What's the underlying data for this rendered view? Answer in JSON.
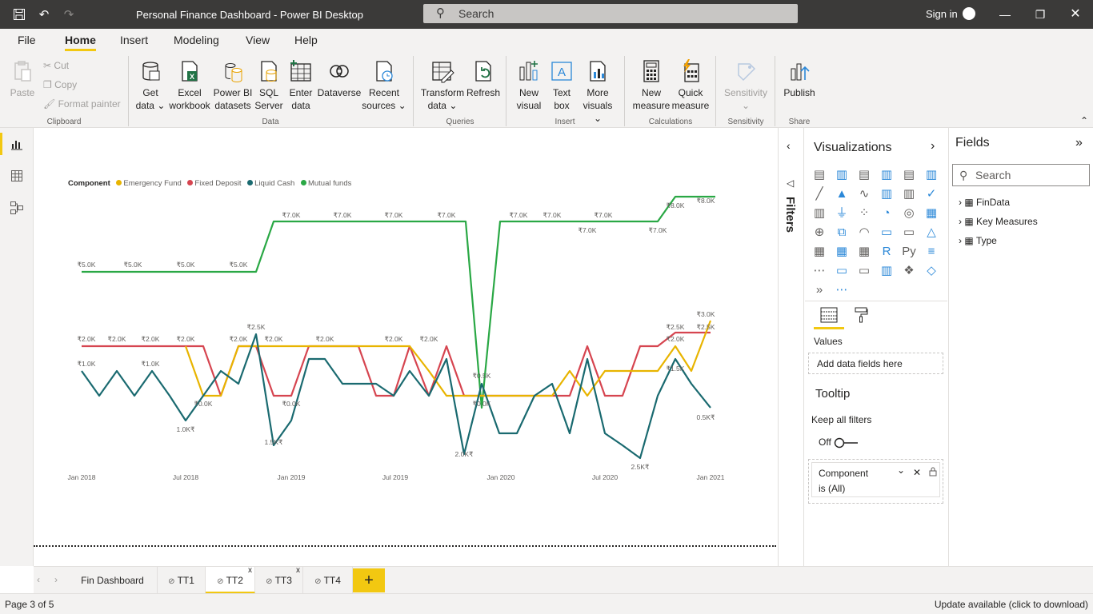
{
  "window": {
    "title": "Personal Finance Dashboard - Power BI Desktop",
    "search_placeholder": "Search",
    "sign_in": "Sign in"
  },
  "menu": [
    "File",
    "Home",
    "Insert",
    "Modeling",
    "View",
    "Help"
  ],
  "ribbon": {
    "clipboard": {
      "paste": "Paste",
      "cut": "Cut",
      "copy": "Copy",
      "format_painter": "Format painter",
      "group": "Clipboard"
    },
    "data": {
      "get_data": [
        "Get",
        "data"
      ],
      "excel": [
        "Excel",
        "workbook"
      ],
      "pbi": [
        "Power BI",
        "datasets"
      ],
      "sql": [
        "SQL",
        "Server"
      ],
      "enter": [
        "Enter",
        "data"
      ],
      "dataverse": "Dataverse",
      "recent": [
        "Recent",
        "sources"
      ],
      "group": "Data"
    },
    "queries": {
      "transform": [
        "Transform",
        "data"
      ],
      "refresh": "Refresh",
      "group": "Queries"
    },
    "insert": {
      "new_visual": [
        "New",
        "visual"
      ],
      "text_box": [
        "Text",
        "box"
      ],
      "more_visuals": [
        "More",
        "visuals"
      ],
      "group": "Insert"
    },
    "calc": {
      "new_measure": [
        "New",
        "measure"
      ],
      "quick_measure": [
        "Quick",
        "measure"
      ],
      "group": "Calculations"
    },
    "sensitivity": {
      "label": "Sensitivity",
      "group": "Sensitivity"
    },
    "share": {
      "publish": "Publish",
      "group": "Share"
    }
  },
  "filters_label": "Filters",
  "visualizations": {
    "title": "Visualizations",
    "values_label": "Values",
    "values_placeholder": "Add data fields here",
    "tooltip_label": "Tooltip",
    "keep_filters": "Keep all filters",
    "toggle_state": "Off",
    "filter_card": {
      "field": "Component",
      "condition": "is (All)"
    }
  },
  "fields": {
    "title": "Fields",
    "search_placeholder": "Search",
    "tables": [
      "FinData",
      "Key Measures",
      "Type"
    ]
  },
  "tabs": [
    {
      "label": "Fin Dashboard",
      "hidden": false
    },
    {
      "label": "TT1",
      "hidden": true
    },
    {
      "label": "TT2",
      "hidden": true
    },
    {
      "label": "TT3",
      "hidden": true
    },
    {
      "label": "TT4",
      "hidden": true
    }
  ],
  "tab_add_glyph": "+",
  "status": {
    "page": "Page 3 of 5",
    "update": "Update available (click to download)"
  },
  "colors": {
    "accent": "#f2c811",
    "emergency": "#e8b400",
    "fixed": "#d64550",
    "liquid": "#1a6a70",
    "mutual": "#2aa845"
  },
  "chart_data": {
    "type": "line",
    "legend_title": "Component",
    "series": [
      {
        "name": "Emergency Fund",
        "color": "#e8b400"
      },
      {
        "name": "Fixed Deposit",
        "color": "#d64550"
      },
      {
        "name": "Liquid Cash",
        "color": "#1a6a70"
      },
      {
        "name": "Mutual funds",
        "color": "#2aa845"
      }
    ],
    "x_ticks": [
      "Jan 2018",
      "Jul 2018",
      "Jan 2019",
      "Jul 2019",
      "Jan 2020",
      "Jul 2020",
      "Jan 2021"
    ],
    "mutual_labels": [
      "₹5.0K",
      "₹5.0K",
      "₹5.0K",
      "₹5.0K",
      "₹7.0K",
      "₹7.0K",
      "₹7.0K",
      "₹7.0K",
      "₹7.0K",
      "₹7.0K",
      "₹7.0K",
      "₹7.0K",
      "₹7.0K",
      "₹8.0K",
      "₹8.0K"
    ],
    "other_labels": [
      "₹2.0K",
      "₹2.0K",
      "₹2.0K",
      "₹2.0K",
      "₹2.5K",
      "₹2.0K",
      "₹2.0K",
      "₹2.0K",
      "₹2.0K",
      "₹2.0K",
      "₹2.5K",
      "₹2.0K",
      "₹3.0K",
      "₹2.5K",
      "₹1.0K",
      "₹1.0K",
      "₹0.0K",
      "₹0.0K",
      "₹0.0K",
      "₹0.5K",
      "1.0K₹",
      "1.5K₹",
      "2.0K₹",
      "2.5K₹",
      "0.5K₹",
      "₹1.5K"
    ]
  }
}
